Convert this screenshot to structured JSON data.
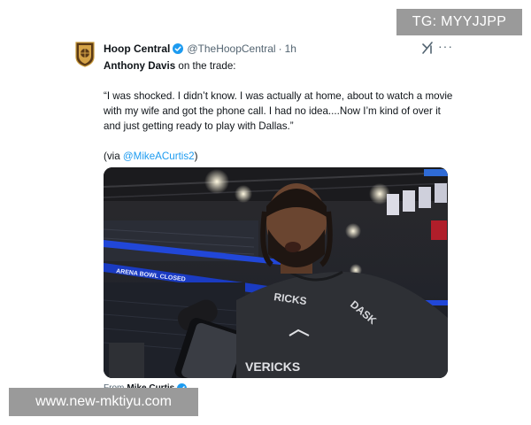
{
  "watermarks": {
    "top": "TG: MYYJJPP",
    "bottom": "www.new-mktiyu.com"
  },
  "tweet": {
    "author_name": "Hoop Central",
    "author_handle": "@TheHoopCentral",
    "separator": "·",
    "time": "1h",
    "more_label": "···",
    "text_bold": "Anthony Davis",
    "text_rest": " on the trade:",
    "quote": "“I was shocked. I didn’t know. I was actually at home, about to watch a movie with my wife and got the phone call. I had no idea....Now I’m kind of over it and just getting ready to play with Dallas.”",
    "via_prefix": "(via ",
    "via_link": "@MikeACurtis2",
    "via_suffix": ")",
    "media": {
      "arena_banner_text": "ARENA BOWL CLOSED",
      "shirt_text_1": "RICKS",
      "shirt_text_2": "DASK",
      "shirt_text_3": "VERICKS"
    },
    "from_prefix": "From",
    "from_author": "Mike Curtis"
  },
  "colors": {
    "verified": "#1d9bf0",
    "link": "#1d9bf0",
    "watermark_bg": "#9a9a9a",
    "secondary_text": "#536471"
  },
  "icons": {
    "avatar": "hoop-central-logo",
    "verified": "verified-badge-icon",
    "grok": "grok-icon",
    "more": "more-icon"
  }
}
